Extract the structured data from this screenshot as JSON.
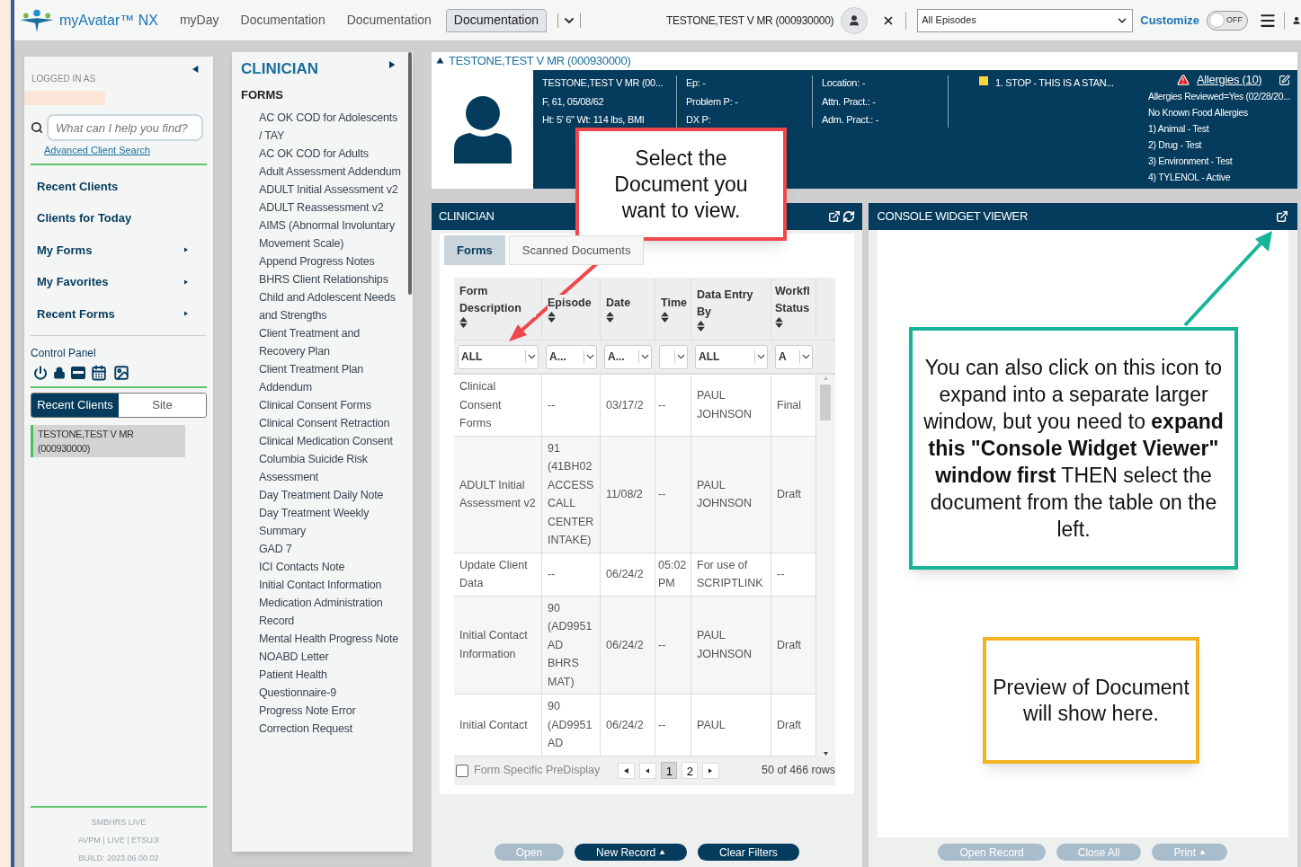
{
  "topbar": {
    "app_name": "myAvatar™ NX",
    "tabs": [
      {
        "label": "myDay",
        "selected": false
      },
      {
        "label": "Documentation",
        "selected": false
      },
      {
        "label": "Documentation",
        "selected": false
      },
      {
        "label": "Documentation",
        "selected": true
      }
    ],
    "client": "TESTONE,TEST V MR (000930000)",
    "episode_select": "All Episodes",
    "customize": "Customize",
    "toggle": {
      "label": "OFF",
      "on": false
    }
  },
  "sidebar": {
    "logged_in_label": "LOGGED IN AS",
    "search": {
      "placeholder": "What can I help you find?"
    },
    "advanced_link": "Advanced Client Search",
    "nav": [
      {
        "label": "Recent Clients",
        "submenu": false
      },
      {
        "label": "Clients for Today",
        "submenu": false
      },
      {
        "label": "My Forms",
        "submenu": true
      },
      {
        "label": "My Favorites",
        "submenu": true
      },
      {
        "label": "Recent Forms",
        "submenu": true
      }
    ],
    "control_panel": "Control Panel",
    "client_tabs": [
      {
        "label": "Recent Clients",
        "selected": true
      },
      {
        "label": "Site",
        "selected": false
      }
    ],
    "recent_clients": [
      "TESTONE,TEST V MR (000930000)"
    ],
    "footer": [
      "SMBHRS LIVE",
      "AVPM | LIVE | ETSUJI",
      "BUILD: 2023.06.00.02"
    ]
  },
  "forms_menu": {
    "title": "CLINICIAN",
    "section": "FORMS",
    "items": [
      "AC OK COD for Adolescents / TAY",
      "AC OK COD for Adults",
      "Adult Assessment Addendum",
      "ADULT Initial Assessment v2",
      "ADULT Reassessment v2",
      "AIMS (Abnormal Involuntary Movement Scale)",
      "Append Progress Notes",
      "BHRS Client Relationships",
      "Child and Adolescent Needs and Strengths",
      "Client Treatment and Recovery Plan",
      "Client Treatment Plan Addendum",
      "Clinical Consent Forms",
      "Clinical Consent Retraction",
      "Clinical Medication Consent",
      "Columbia Suicide Risk Assessment",
      "Day Treatment Daily Note",
      "Day Treatment Weekly Summary",
      "GAD 7",
      "ICI Contacts Note",
      "Initial Contact Information",
      "Medication Administration Record",
      "Mental Health Progress Note",
      "NOABD Letter",
      "Patient Health Questionnaire-9",
      "Progress Note Error Correction Request"
    ]
  },
  "client_header": {
    "title": "TESTONE,TEST V MR (000930000)",
    "columns": [
      [
        "TESTONE,TEST V MR (00...",
        "F, 61, 05/08/62",
        "Ht: 5' 6\" Wt: 114 lbs, BMI"
      ],
      [
        "Ep: -",
        "Problem P: -",
        "DX P:"
      ],
      [
        "Location: -",
        "Attn. Pract.: -",
        "Adm. Pract.: -"
      ]
    ],
    "alert": "1. STOP - THIS IS A STAN...",
    "allergies_title": "Allergies (10)",
    "allergies": [
      "Allergies Reviewed=Yes (02/28/20...",
      "No Known Food Allergies",
      "1) Animal - Test",
      "2) Drug - Test",
      "3) Environment - Test",
      "4) TYLENOL - Active"
    ]
  },
  "clinician_panel": {
    "title": "CLINICIAN",
    "tabs": [
      {
        "label": "Forms",
        "selected": true
      },
      {
        "label": "Scanned Documents",
        "selected": false
      }
    ],
    "table": {
      "columns": [
        {
          "label": "Form Description",
          "filter": "ALL"
        },
        {
          "label": "Episode",
          "filter": "A..."
        },
        {
          "label": "Date",
          "filter": "A..."
        },
        {
          "label": "Time"
        },
        {
          "label": "Data Entry By",
          "filter": "ALL"
        },
        {
          "label": "Workfl Status",
          "filter": "A"
        }
      ],
      "rows": [
        [
          "Clinical Consent Forms",
          "--",
          "03/17/2",
          "--",
          "PAUL JOHNSON",
          "Final"
        ],
        [
          "ADULT Initial Assessment v2",
          "91 (41BH02 ACCESS CALL CENTER INTAKE)",
          "11/08/2",
          "--",
          "PAUL JOHNSON",
          "Draft"
        ],
        [
          "Update Client Data",
          "--",
          "06/24/2",
          "05:02 PM",
          "For use of SCRIPTLINK",
          "--"
        ],
        [
          "Initial Contact Information",
          "90 (AD9951 AD BHRS MAT)",
          "06/24/2",
          "--",
          "PAUL JOHNSON",
          "Draft"
        ],
        [
          "Initial Contact",
          "90 (AD9951 AD",
          "06/24/2",
          "--",
          "PAUL",
          "Draft"
        ]
      ]
    },
    "predisplay": {
      "label": "Form Specific PreDisplay",
      "checked": false
    },
    "pages": [
      {
        "label": "1",
        "selected": true
      },
      {
        "label": "2",
        "selected": false
      }
    ],
    "row_count": "50 of 466 rows",
    "buttons": [
      {
        "label": "Open",
        "disabled": true,
        "menu": false
      },
      {
        "label": "New Record",
        "disabled": false,
        "menu": true
      },
      {
        "label": "Clear Filters",
        "disabled": false,
        "menu": false
      }
    ]
  },
  "console_panel": {
    "title": "CONSOLE WIDGET VIEWER",
    "buttons": [
      {
        "label": "Open Record",
        "disabled": true,
        "menu": false
      },
      {
        "label": "Close All",
        "disabled": true,
        "menu": false
      },
      {
        "label": "Print",
        "disabled": true,
        "menu": true
      }
    ]
  },
  "annotations": [
    {
      "text": "Select the Document you want to view.",
      "color": "#f0474b"
    },
    {
      "text": "You can also click on this icon to expand into a separate larger window, but you need to **expand this \"Console Widget Viewer\" window first** THEN select the document from the table on the left.",
      "color": "#19b39a"
    },
    {
      "text": "Preview of Document will show here.",
      "color": "#f5b324"
    }
  ]
}
